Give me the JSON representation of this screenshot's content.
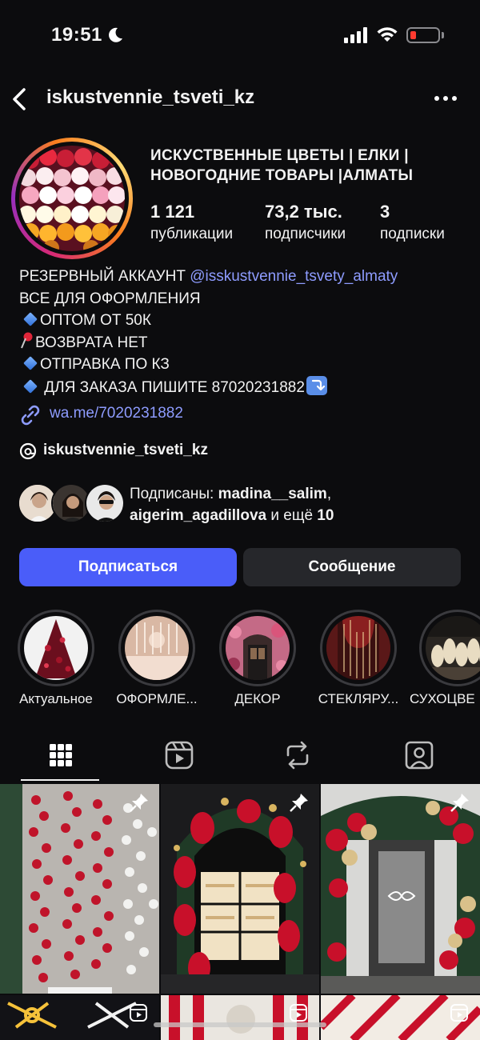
{
  "status_bar": {
    "time": "19:51",
    "battery_level": 0.2,
    "battery_color": "#ff3b30"
  },
  "header": {
    "username": "iskustvennie_tsveti_kz"
  },
  "profile": {
    "display_name_line1": "ИСКУСТВЕННЫЕ ЦВЕТЫ | ЕЛКИ |",
    "display_name_line2": "НОВОГОДНИЕ ТОВАРЫ |АЛМАТЫ",
    "stats": [
      {
        "value": "1 121",
        "label": "публикации"
      },
      {
        "value": "73,2 тыс.",
        "label": "подписчики"
      },
      {
        "value": "3",
        "label": "подписки"
      }
    ]
  },
  "bio": {
    "line1_prefix": "РЕЗЕРВНЫЙ АККАУНТ ",
    "line1_mention": "@isskustvennie_tsvety_almaty",
    "line2": "ВСЕ ДЛЯ ОФОРМЛЕНИЯ",
    "line3": "ОПТОМ ОТ 50К",
    "line4": "ВОЗВРАТА НЕТ",
    "line5": "ОТПРАВКА ПО КЗ",
    "line6": " ДЛЯ ЗАКАЗА ПИШИТЕ 87020231882",
    "link": "wa.me/7020231882",
    "threads_handle": "iskustvennie_tsveti_kz"
  },
  "followed_by": {
    "prefix": "Подписаны: ",
    "user1": "madina__salim",
    "separator": ",",
    "user2": "aigerim_agadillova",
    "middle": " и ещё ",
    "count": "10"
  },
  "actions": {
    "follow": "Подписаться",
    "message": "Сообщение"
  },
  "highlights": [
    {
      "label": "Актуальное"
    },
    {
      "label": "ОФОРМЛЕ..."
    },
    {
      "label": "ДЕКОР"
    },
    {
      "label": "СТЕКЛЯРУ..."
    },
    {
      "label": "СУХОЦВЕ"
    }
  ],
  "tabs": [
    {
      "icon": "grid-icon",
      "active": true
    },
    {
      "icon": "reels-icon",
      "active": false
    },
    {
      "icon": "repost-icon",
      "active": false
    },
    {
      "icon": "tagged-icon",
      "active": false
    }
  ],
  "colors": {
    "accent": "#4a5df9",
    "link": "#8e9cff",
    "background": "#0c0c0e"
  }
}
